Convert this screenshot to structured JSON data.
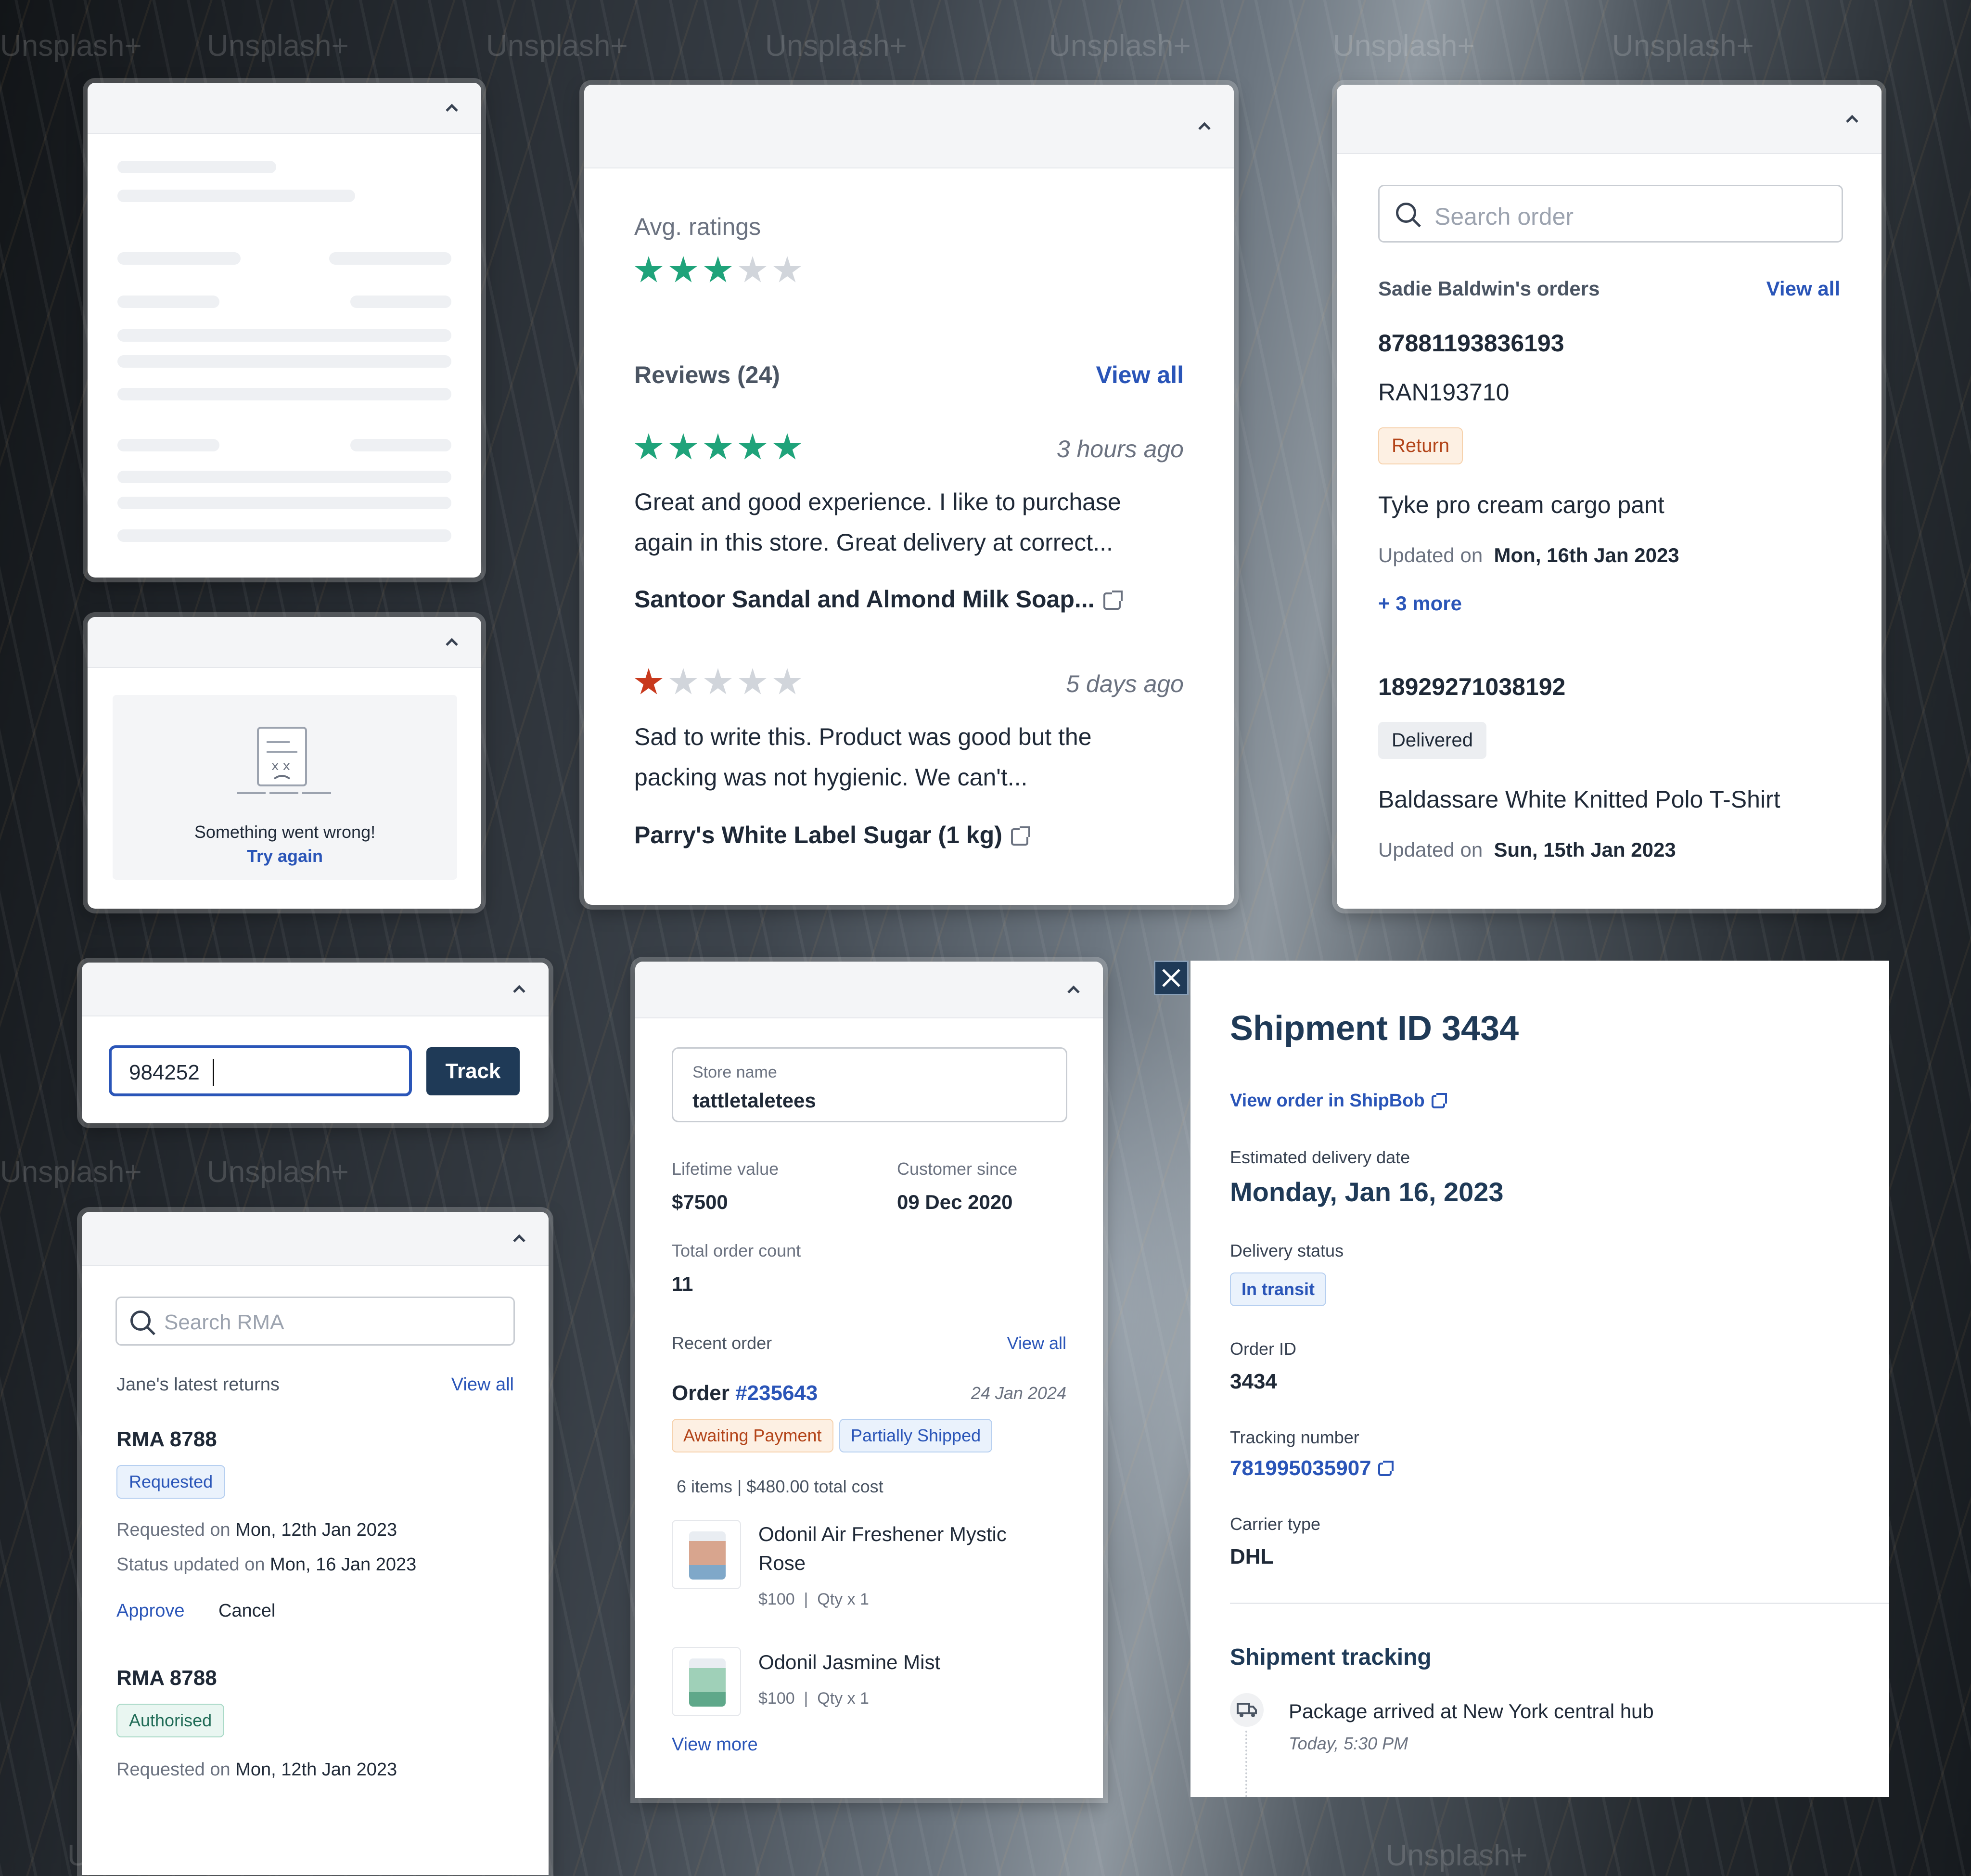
{
  "watermark": "Unsplash+",
  "error_card": {
    "message": "Something went wrong!",
    "retry": "Try again"
  },
  "reviews_card": {
    "avg_label": "Avg. ratings",
    "avg_rating": 3,
    "max_rating": 5,
    "reviews_title": "Reviews (24)",
    "view_all": "View all",
    "reviews": [
      {
        "rating": 5,
        "time": "3 hours ago",
        "text_line1": "Great and good experience. I like to purchase",
        "text_line2": "again in this store. Great delivery at correct...",
        "product": "Santoor Sandal and Almond Milk Soap..."
      },
      {
        "rating": 1,
        "time": "5 days ago",
        "text_line1": "Sad to write this. Product was good but the",
        "text_line2": "packing was not hygienic. We can't...",
        "product": "Parry's White Label Sugar (1 kg)"
      }
    ]
  },
  "orders_card": {
    "search_placeholder": "Search order",
    "title": "Sadie Baldwin's orders",
    "view_all": "View all",
    "order1": {
      "id": "87881193836193",
      "ref": "RAN193710",
      "status": "Return",
      "product": "Tyke pro cream cargo pant",
      "updated_label": "Updated on",
      "updated_value": "Mon, 16th Jan 2023",
      "more": "+ 3 more"
    },
    "order2": {
      "id": "18929271038192",
      "status": "Delivered",
      "product": "Baldassare White Knitted Polo T-Shirt",
      "updated_label": "Updated on",
      "updated_value": "Sun, 15th Jan 2023"
    }
  },
  "track_card": {
    "input_value": "984252",
    "button": "Track"
  },
  "rma_card": {
    "search_placeholder": "Search RMA",
    "title": "Jane's latest returns",
    "view_all": "View all",
    "rma1": {
      "id": "RMA 8788",
      "status": "Requested",
      "requested_label": "Requested on",
      "requested_value": "Mon, 12th Jan 2023",
      "status_label": "Status updated on",
      "status_value": "Mon, 16 Jan 2023",
      "approve": "Approve",
      "cancel": "Cancel"
    },
    "rma2": {
      "id": "RMA 8788",
      "status": "Authorised",
      "requested_label": "Requested on",
      "requested_value": "Mon, 12th Jan 2023"
    }
  },
  "customer_card": {
    "store_label": "Store name",
    "store_value": "tattletaletees",
    "lifetime_label": "Lifetime value",
    "lifetime_value": "$7500",
    "since_label": "Customer since",
    "since_value": "09 Dec 2020",
    "count_label": "Total order count",
    "count_value": "11",
    "recent_label": "Recent order",
    "view_all": "View all",
    "order_prefix": "Order",
    "order_number": "#235643",
    "order_date": "24 Jan 2024",
    "badge_payment": "Awaiting Payment",
    "badge_shipping": "Partially Shipped",
    "summary": "6 items | $480.00 total cost",
    "items": [
      {
        "name_line1": "Odonil Air Freshener Mystic",
        "name_line2": "Rose",
        "price": "$100",
        "qty": "Qty x 1"
      },
      {
        "name_line1": "Odonil Jasmine Mist",
        "price": "$100",
        "qty": "Qty x 1"
      }
    ],
    "view_more": "View more"
  },
  "shipment_card": {
    "title": "Shipment ID 3434",
    "view_order": "View order in ShipBob",
    "eta_label": "Estimated delivery date",
    "eta_value": "Monday, Jan 16, 2023",
    "status_label": "Delivery status",
    "status_value": "In transit",
    "order_label": "Order ID",
    "order_value": "3434",
    "tracking_label": "Tracking number",
    "tracking_value": "781995035907",
    "carrier_label": "Carrier type",
    "carrier_value": "DHL",
    "tracking_title": "Shipment tracking",
    "event_text": "Package arrived at New York central hub",
    "event_time": "Today, 5:30 PM"
  },
  "colors": {
    "accent": "#2a55b8",
    "star": "#1fa37a",
    "bad_star": "#c8391d",
    "navy": "#1f3a57"
  }
}
